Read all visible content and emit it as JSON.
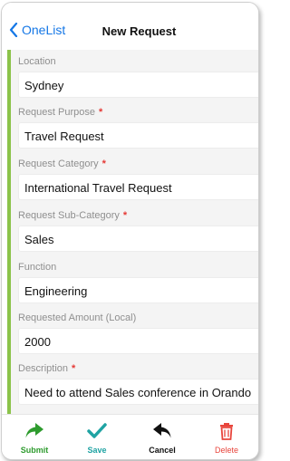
{
  "nav": {
    "back_label": "OneList",
    "title": "New Request"
  },
  "form": {
    "fields": [
      {
        "label": "Location",
        "required": false,
        "value": "Sydney"
      },
      {
        "label": "Request Purpose",
        "required": true,
        "value": "Travel Request"
      },
      {
        "label": "Request Category",
        "required": true,
        "value": "International Travel Request"
      },
      {
        "label": "Request Sub-Category",
        "required": true,
        "value": "Sales"
      },
      {
        "label": "Function",
        "required": false,
        "value": "Engineering"
      },
      {
        "label": "Requested Amount (Local)",
        "required": false,
        "value": "2000"
      },
      {
        "label": "Description",
        "required": true,
        "value": "Need to attend Sales conference in Orando"
      }
    ],
    "required_marker": "*"
  },
  "toolbar": {
    "submit_label": "Submit",
    "save_label": "Save",
    "cancel_label": "Cancel",
    "delete_label": "Delete",
    "submit_icon": "share-arrow-icon",
    "save_icon": "checkmark-icon",
    "cancel_icon": "reply-arrow-icon",
    "delete_icon": "trash-icon",
    "submit_color": "#2e9b2e",
    "save_color": "#1fa3a3",
    "cancel_color": "#111111",
    "delete_color": "#e8453c"
  },
  "theme": {
    "accent": "#8bc34a",
    "link": "#1577e6",
    "required": "#e53935"
  }
}
